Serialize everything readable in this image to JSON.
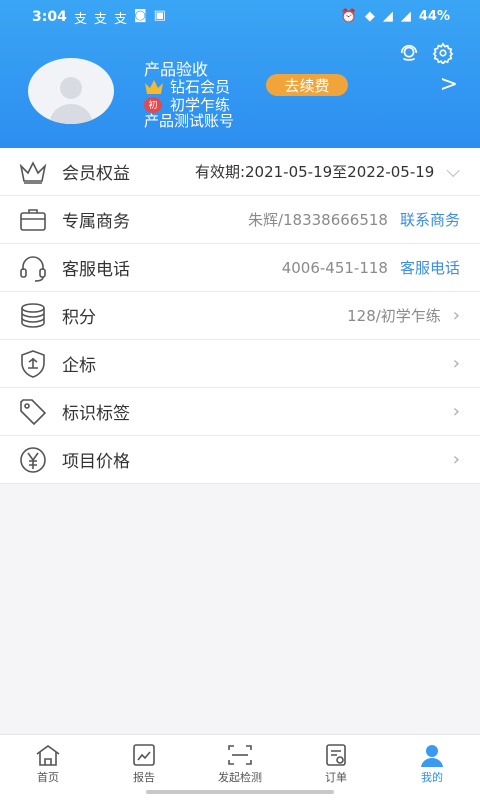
{
  "status_bar": {
    "time": "3:04",
    "left_icons": [
      "支",
      "支",
      "支"
    ],
    "battery": "44%"
  },
  "profile": {
    "name": "产品验收",
    "member_level": "钻石会员",
    "renew_label": "去续费",
    "learner_badge": "初",
    "learner_level": "初学乍练",
    "account_label": "产品测试账号"
  },
  "list": {
    "membership": {
      "title": "会员权益",
      "validity": "有效期:2021-05-19至2022-05-19"
    },
    "business": {
      "title": "专属商务",
      "value": "朱辉/18338666518",
      "link": "联系商务"
    },
    "service": {
      "title": "客服电话",
      "value": "4006-451-118",
      "link": "客服电话"
    },
    "points": {
      "title": "积分",
      "value": "128/初学乍练"
    },
    "enterprise": {
      "title": "企标"
    },
    "tags": {
      "title": "标识标签"
    },
    "pricing": {
      "title": "项目价格"
    }
  },
  "nav": {
    "home": "首页",
    "report": "报告",
    "detect": "发起检测",
    "orders": "订单",
    "mine": "我的"
  },
  "colors": {
    "header_top": "#3aa5f4",
    "header_bottom": "#2d8ef0",
    "renew": "#f0a43a",
    "link": "#3a8ee6",
    "active_tab": "#2d8ef0"
  }
}
